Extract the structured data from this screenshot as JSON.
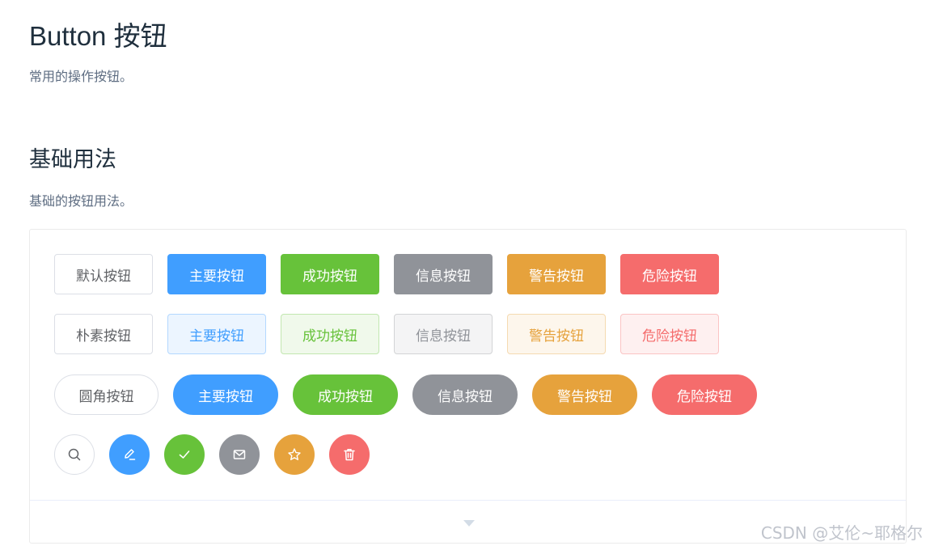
{
  "header": {
    "title": "Button 按钮",
    "description": "常用的操作按钮。"
  },
  "section": {
    "title": "基础用法",
    "description": "基础的按钮用法。"
  },
  "rows": {
    "default": [
      "默认按钮",
      "主要按钮",
      "成功按钮",
      "信息按钮",
      "警告按钮",
      "危险按钮"
    ],
    "plain": [
      "朴素按钮",
      "主要按钮",
      "成功按钮",
      "信息按钮",
      "警告按钮",
      "危险按钮"
    ],
    "round": [
      "圆角按钮",
      "主要按钮",
      "成功按钮",
      "信息按钮",
      "警告按钮",
      "危险按钮"
    ]
  },
  "circle_icons": [
    "search-icon",
    "edit-icon",
    "check-icon",
    "message-icon",
    "star-icon",
    "delete-icon"
  ],
  "colors": {
    "primary": "#409eff",
    "success": "#67c23a",
    "info": "#909399",
    "warning": "#e6a23c",
    "danger": "#f56c6c"
  },
  "watermark": "CSDN @艾伦~耶格尔"
}
